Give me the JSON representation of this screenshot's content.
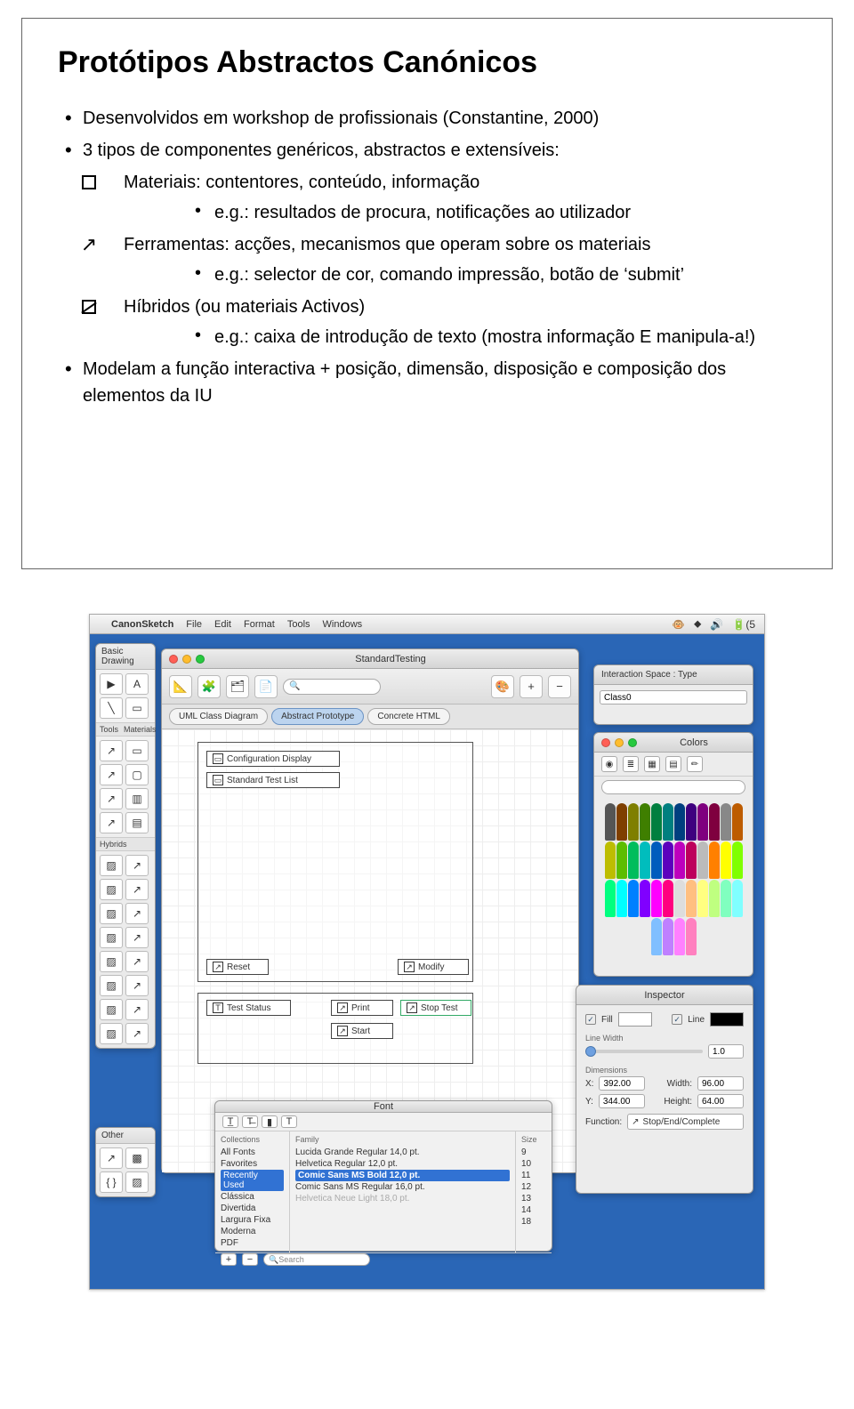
{
  "slide": {
    "title": "Protótipos Abstractos Canónicos",
    "items": [
      "Desenvolvidos em workshop de profissionais (Constantine, 2000)",
      "3 tipos de componentes genéricos, abstractos e extensíveis:"
    ],
    "types": [
      {
        "label": "Materiais: contentores, conteúdo, informação",
        "example": "e.g.: resultados de procura, notificações ao utilizador",
        "symbol": "box"
      },
      {
        "label": "Ferramentas: acções, mecanismos que operam sobre os materiais",
        "example": "e.g.: selector de cor, comando impressão, botão de ‘submit’",
        "symbol": "arrow"
      },
      {
        "label": "Híbridos (ou materiais Activos)",
        "example": "e.g.: caixa de introdução de texto (mostra informação E manipula-a!)",
        "symbol": "hybrid"
      }
    ],
    "closing": "Modelam a função interactiva + posição, dimensão, disposição e composição dos elementos da IU"
  },
  "app": {
    "menubar": {
      "appname": "CanonSketch",
      "items": [
        "File",
        "Edit",
        "Format",
        "Tools",
        "Windows"
      ],
      "right_battery": "(5"
    },
    "palettes": {
      "basic_title": "Basic Drawing",
      "section_tools": "Tools",
      "section_materials": "Materials",
      "section_hybrids": "Hybrids",
      "other_title": "Other"
    },
    "doc": {
      "title": "StandardTesting",
      "search_placeholder": "",
      "toolbar_plus": "+",
      "toolbar_minus": "−",
      "tabs": [
        "UML Class Diagram",
        "Abstract Prototype",
        "Concrete HTML"
      ],
      "active_tab": 1,
      "boxes": {
        "config": "Configuration Display",
        "list": "Standard Test List",
        "reset": "Reset",
        "modify": "Modify",
        "test_status": "Test Status",
        "print": "Print",
        "stop_test": "Stop Test",
        "start": "Start"
      }
    },
    "fontpanel": {
      "title": "Font",
      "collections_hdr": "Collections",
      "collections": [
        "All Fonts",
        "Favorites",
        "Recently Used",
        "Clássica",
        "Divertida",
        "Largura Fixa",
        "Moderna",
        "PDF"
      ],
      "collections_sel": 2,
      "family_hdr": "Family",
      "families": [
        "Lucida Grande Regular 14,0 pt.",
        "Helvetica Regular 12,0 pt.",
        "Comic Sans MS Bold 12,0 pt.",
        "Comic Sans MS Regular 16,0 pt.",
        "Helvetica Neue Light 18,0 pt."
      ],
      "family_sel": 2,
      "size_hdr": "Size",
      "sizes": [
        "9",
        "10",
        "11",
        "12",
        "13",
        "14",
        "18"
      ],
      "search_placeholder": "Search"
    },
    "ptype": {
      "title": "Interaction Space : Type",
      "value": "Class0"
    },
    "colors": {
      "title": "Colors",
      "search": ""
    },
    "inspector": {
      "title": "Inspector",
      "fill_label": "Fill",
      "line_label": "Line",
      "fill_color": "#ffffff",
      "line_color": "#000000",
      "linewidth_label": "Line Width",
      "linewidth_value": "1.0",
      "dimensions_label": "Dimensions",
      "x_label": "X:",
      "x_value": "392.00",
      "width_label": "Width:",
      "width_value": "96.00",
      "y_label": "Y:",
      "y_value": "344.00",
      "height_label": "Height:",
      "height_value": "64.00",
      "function_label": "Function:",
      "function_value": "Stop/End/Complete"
    }
  },
  "crayon_colors": [
    "#555",
    "#7f3f00",
    "#7f7f00",
    "#3f7f00",
    "#007f3f",
    "#007f7f",
    "#003f7f",
    "#3f007f",
    "#7f007f",
    "#7f003f",
    "#888",
    "#bd5c00",
    "#bdbd00",
    "#5cbd00",
    "#00bd5c",
    "#00bdbd",
    "#005cbd",
    "#5c00bd",
    "#bd00bd",
    "#bd005c",
    "#bbb",
    "#ff8000",
    "#ffff00",
    "#80ff00",
    "#00ff80",
    "#00ffff",
    "#0080ff",
    "#8000ff",
    "#ff00ff",
    "#ff0080",
    "#ddd",
    "#ffbf80",
    "#ffff80",
    "#bfff80",
    "#80ffbf",
    "#80ffff",
    "#80bfff",
    "#bf80ff",
    "#ff80ff",
    "#ff80bf"
  ]
}
